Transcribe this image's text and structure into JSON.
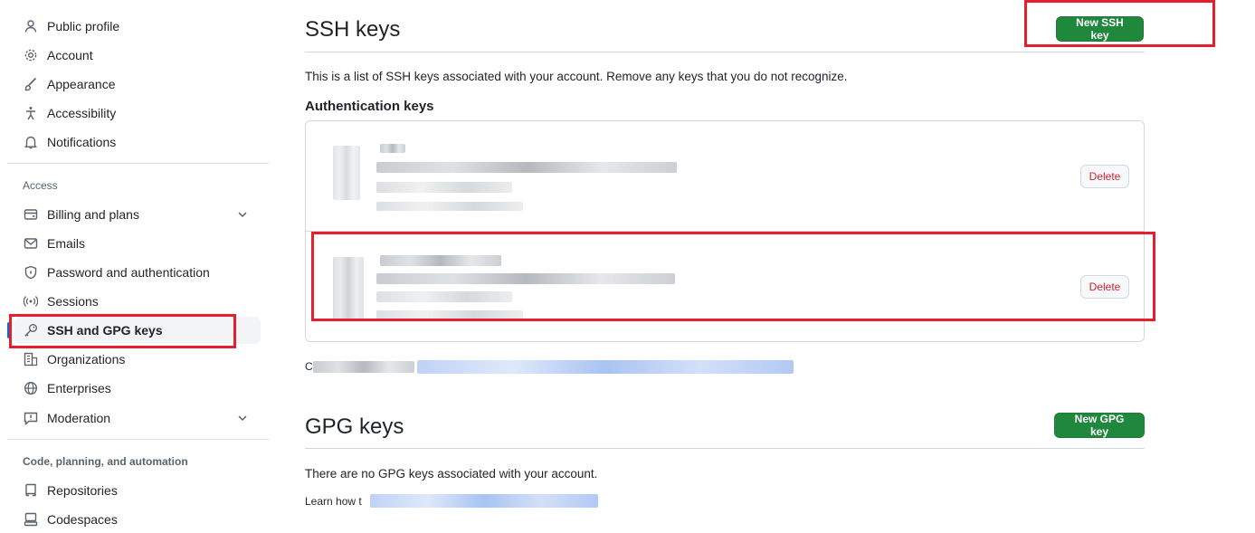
{
  "sidebar": {
    "top_items": [
      {
        "label": "Public profile",
        "icon": "person-icon"
      },
      {
        "label": "Account",
        "icon": "gear-icon"
      },
      {
        "label": "Appearance",
        "icon": "paintbrush-icon"
      },
      {
        "label": "Accessibility",
        "icon": "accessibility-icon"
      },
      {
        "label": "Notifications",
        "icon": "bell-icon"
      }
    ],
    "access_title": "Access",
    "access_items": [
      {
        "label": "Billing and plans",
        "icon": "credit-card-icon"
      },
      {
        "label": "Emails",
        "icon": "mail-icon"
      },
      {
        "label": "Password and authentication",
        "icon": "shield-lock-icon"
      },
      {
        "label": "Sessions",
        "icon": "broadcast-icon"
      },
      {
        "label": "SSH and GPG keys",
        "icon": "key-icon"
      },
      {
        "label": "Organizations",
        "icon": "organization-icon"
      },
      {
        "label": "Enterprises",
        "icon": "globe-icon"
      },
      {
        "label": "Moderation",
        "icon": "report-icon"
      }
    ],
    "code_title": "Code, planning, and automation",
    "code_items": [
      {
        "label": "Repositories",
        "icon": "repo-icon"
      },
      {
        "label": "Codespaces",
        "icon": "codespaces-icon"
      }
    ]
  },
  "ssh": {
    "title": "SSH keys",
    "new_button": "New SSH key",
    "description": "This is a list of SSH keys associated with your account. Remove any keys that you do not recognize.",
    "auth_title": "Authentication keys",
    "delete_label": "Delete",
    "footer_prefix": "C"
  },
  "gpg": {
    "title": "GPG keys",
    "new_button": "New GPG key",
    "empty_text": "There are no GPG keys associated with your account.",
    "learn_prefix": "Learn how t"
  },
  "colors": {
    "accent": "#1f883d",
    "danger": "#d1242f",
    "link": "#0969da",
    "highlight": "#e5202e"
  }
}
